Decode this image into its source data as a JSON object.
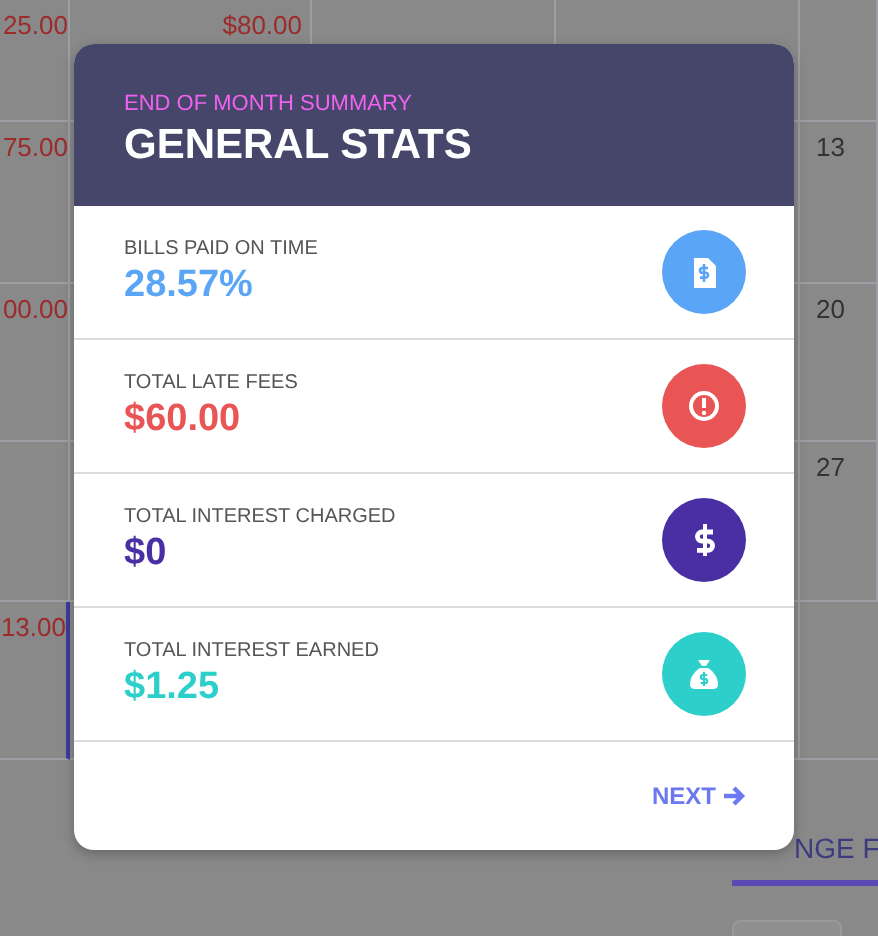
{
  "calendar": {
    "rows": [
      {
        "column_1": "25.00",
        "column_2": "$80.00",
        "selected": false
      },
      {
        "column_1": "75.00",
        "column_5": "13",
        "selected": false
      },
      {
        "column_1": "00.00",
        "column_5": "20",
        "selected": false
      },
      {
        "column_5": "27",
        "selected": false
      },
      {
        "column_1": "13.00",
        "selected": true
      }
    ],
    "tab": {
      "label": "NGE F",
      "selected": true
    }
  },
  "modal": {
    "subtitle": "END OF MONTH SUMMARY",
    "title": "GENERAL STATS",
    "stats": [
      {
        "label": "BILLS PAID ON TIME",
        "value": "28.57%",
        "kind": "bill",
        "color": "#5aa5f5"
      },
      {
        "label": "TOTAL LATE FEES",
        "value": "$60.00",
        "kind": "alert",
        "color": "#e95455"
      },
      {
        "label": "TOTAL INTEREST CHARGED",
        "value": "$0",
        "kind": "dollar",
        "color": "#4a2fa4"
      },
      {
        "label": "TOTAL INTEREST EARNED",
        "value": "$1.25",
        "kind": "bag",
        "color": "#2dcfcb"
      }
    ],
    "next_button": "NEXT"
  }
}
